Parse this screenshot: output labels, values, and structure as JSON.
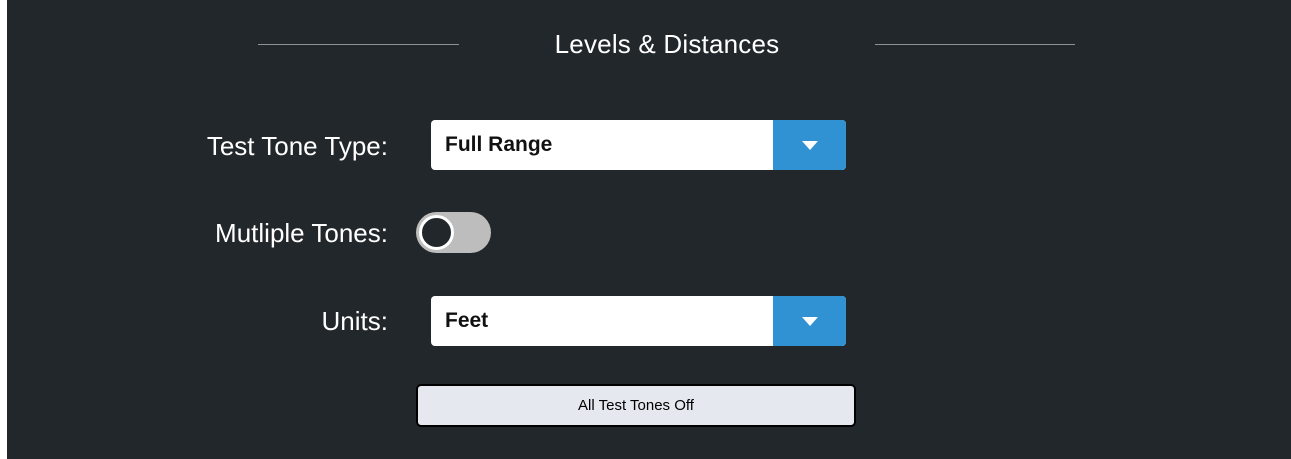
{
  "panel": {
    "title": "Levels & Distances"
  },
  "test_tone_type": {
    "label": "Test Tone Type:",
    "value": "Full Range",
    "dropdown_icon": "chevron-down-icon"
  },
  "multiple_tones": {
    "label": "Mutliple Tones:",
    "enabled": false
  },
  "units": {
    "label": "Units:",
    "value": "Feet",
    "dropdown_icon": "chevron-down-icon"
  },
  "actions": {
    "all_off_label": "All Test Tones Off"
  },
  "colors": {
    "background": "#22272b",
    "accent": "#3192d3",
    "toggle_track": "#bdbdbd",
    "button_bg": "#e6e8ef"
  }
}
